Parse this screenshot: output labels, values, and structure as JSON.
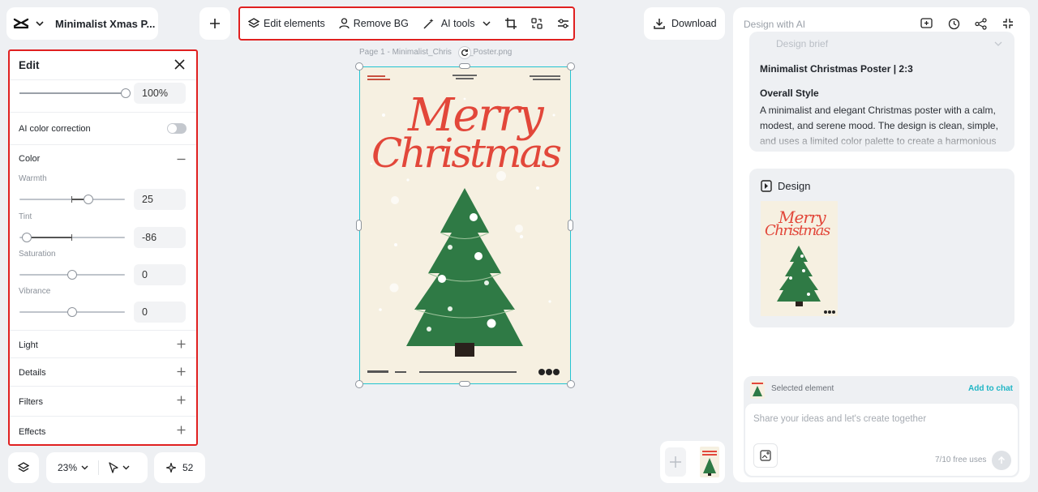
{
  "project": {
    "title": "Minimalist Xmas P..."
  },
  "toolbar": {
    "edit_elements": "Edit elements",
    "remove_bg": "Remove BG",
    "ai_tools": "AI tools"
  },
  "download": {
    "label": "Download"
  },
  "edit_panel": {
    "title": "Edit",
    "opacity_value": "100%",
    "ai_color_correction": "AI color correction",
    "color_section": "Color",
    "warmth": {
      "label": "Warmth",
      "value": "25",
      "level": 0.65
    },
    "tint": {
      "label": "Tint",
      "value": "-86",
      "level": 0.07
    },
    "saturation": {
      "label": "Saturation",
      "value": "0",
      "level": 0.5
    },
    "vibrance": {
      "label": "Vibrance",
      "value": "0",
      "level": 0.5
    },
    "sections": [
      "Light",
      "Details",
      "Filters",
      "Effects"
    ]
  },
  "bottom_controls": {
    "zoom": "23%",
    "credits": "52"
  },
  "canvas": {
    "page_label": "Page 1 -   Minimalist_Chris",
    "page_label_tail": "s_Poster.png",
    "poster_line1": "Merry",
    "poster_line2": "Christmas"
  },
  "right_panel": {
    "header": "Design with AI",
    "brief_heading": "Design brief",
    "brief_title": "Minimalist Christmas Poster | 2:3",
    "overall_style": "Overall Style",
    "brief_text": "A minimalist and elegant Christmas poster with a calm, modest, and serene mood. The design is clean, simple, and uses a limited color palette to create a harmonious",
    "design_label": "Design",
    "thumb_line1": "Merry",
    "thumb_line2": "Christmas",
    "selected_element": "Selected element",
    "add_to_chat": "Add to chat",
    "chat_placeholder": "Share your ideas and let's create together",
    "free_uses": "7/10 free uses"
  },
  "colors": {
    "accent_red": "#e02020",
    "selection": "#23c4d2",
    "poster_red": "#e2473a",
    "tree_green": "#2f7a45",
    "link": "#1fb5c5"
  }
}
